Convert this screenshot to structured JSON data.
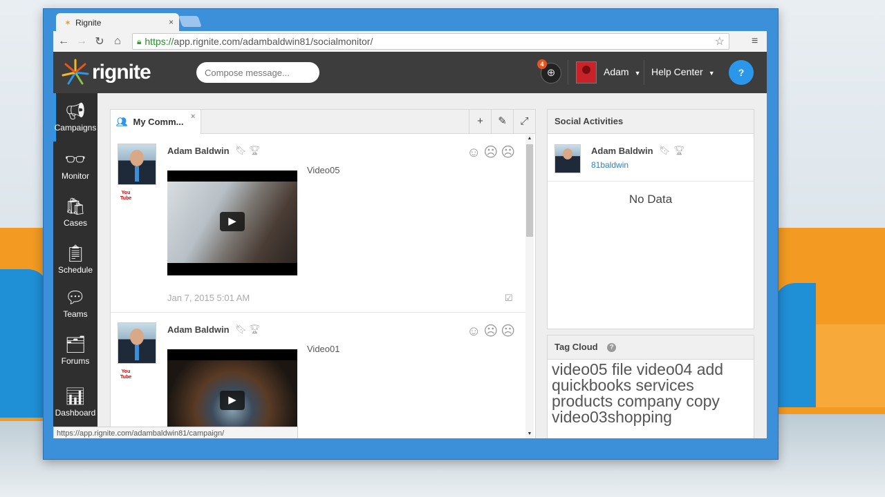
{
  "browser": {
    "tab_title": "Rignite",
    "tab_close": "×",
    "url_green": "https://",
    "url_rest": "app.rignite.com/adambaldwin81/socialmonitor/",
    "status_url": "https://app.rignite.com/adambaldwin81/campaign/",
    "icons": {
      "back": "arrow-left-icon",
      "forward": "arrow-right-icon",
      "reload": "reload-icon",
      "home": "home-icon",
      "star": "star-icon",
      "menu": "menu-icon"
    }
  },
  "header": {
    "logo_text": "rignite",
    "compose_placeholder": "Compose message...",
    "notification_count": "4",
    "user_name": "Adam",
    "help_center": "Help Center",
    "help_button": "?",
    "accent_color": "#2b97ea"
  },
  "sidebar": {
    "items": [
      {
        "label": "Campaigns",
        "icon": "megaphone-icon"
      },
      {
        "label": "Monitor",
        "icon": "binoculars-icon"
      },
      {
        "label": "Cases",
        "icon": "bag-icon"
      },
      {
        "label": "Schedule",
        "icon": "clipboard-icon"
      },
      {
        "label": "Teams",
        "icon": "chat-bubbles-icon"
      },
      {
        "label": "Forums",
        "icon": "forum-icon"
      },
      {
        "label": "Dashboard",
        "icon": "bar-chart-icon"
      }
    ]
  },
  "stream": {
    "tab_label": "My Comm...",
    "tab_close": "×",
    "posts": [
      {
        "author": "Adam Baldwin",
        "title": "Video05",
        "time": "Jan 7, 2015 5:01 AM",
        "source": "YouTube"
      },
      {
        "author": "Adam Baldwin",
        "title": "Video01",
        "time": "",
        "source": "YouTube"
      }
    ]
  },
  "social_activities": {
    "title": "Social Activities",
    "user_name": "Adam Baldwin",
    "handle": "81baldwin",
    "empty_text": "No Data"
  },
  "tag_cloud": {
    "title": "Tag Cloud",
    "help": "?",
    "tags": "video05 file video04 add quickbooks services products company copy video03shopping"
  }
}
